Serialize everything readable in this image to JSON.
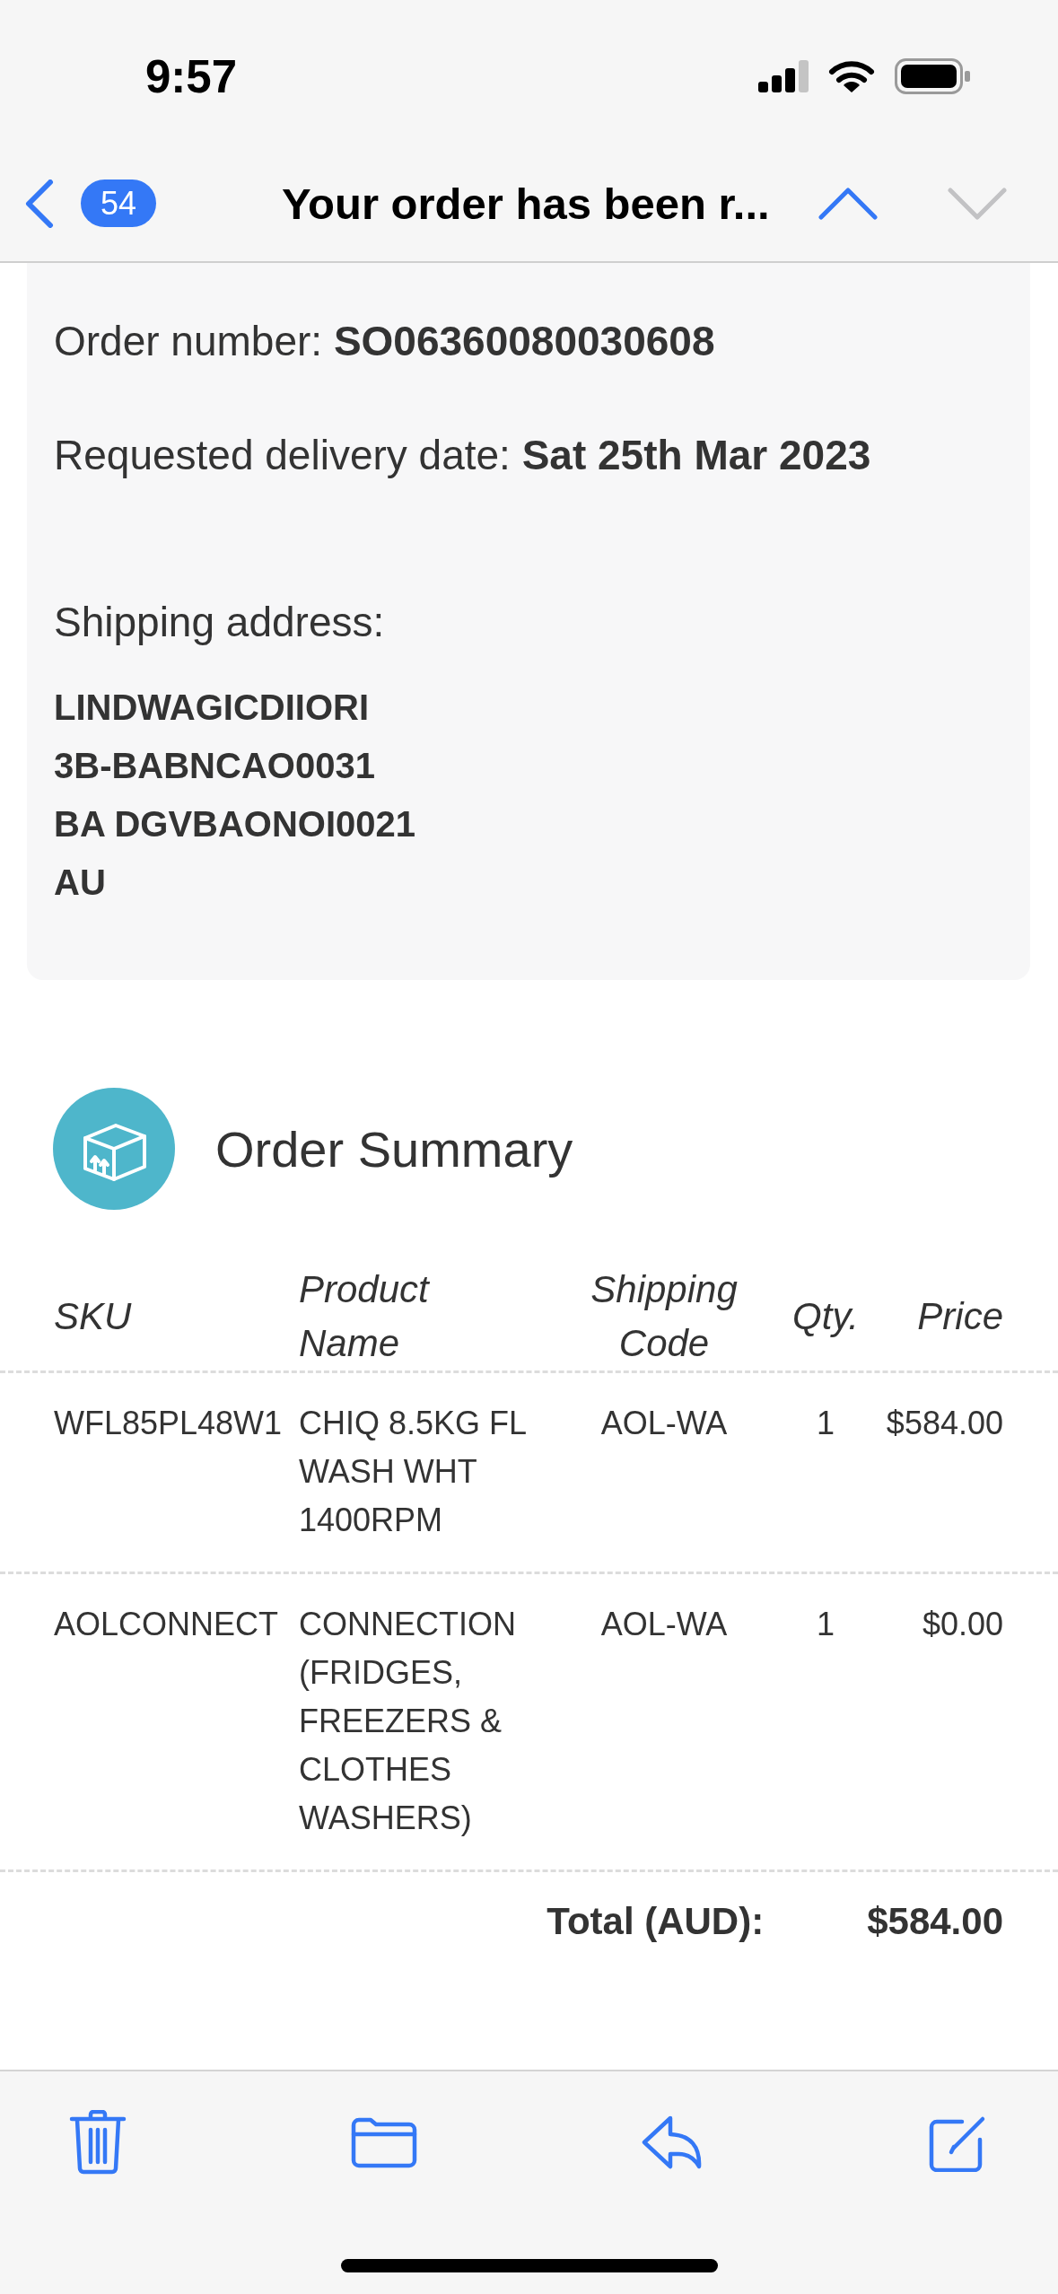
{
  "status_bar": {
    "time": "9:57"
  },
  "nav_bar": {
    "unread_count": "54",
    "title": "Your order has been r...",
    "arrows": [
      {
        "kind": "up",
        "disabled": false
      },
      {
        "kind": "down",
        "disabled": true
      }
    ]
  },
  "order_details": {
    "lines": [
      "Order number: **SO06360080030608**",
      "Requested delivery date: **Sat 25th Mar 2023**"
    ],
    "shipping_label": "Shipping address:",
    "address_lines": [
      "LINDWAGICDIIORI",
      "3B-BABNCAO0031",
      "BA DGVBAONOI0021",
      "AU"
    ]
  },
  "order_summary": {
    "title": "Order Summary",
    "columns": [
      "SKU",
      "Product Name",
      "Shipping Code",
      "Qty.",
      "Price"
    ],
    "rows": [
      {
        "sku": "WFL85PL48W1",
        "product_name": "CHIQ 8.5KG FL WASH WHT 1400RPM",
        "shipping_code": "AOL-WA",
        "qty": "1",
        "price": "$584.00"
      },
      {
        "sku": "AOLCONNECT",
        "product_name": "CONNECTION (FRIDGES, FREEZERS & CLOTHES WASHERS)",
        "shipping_code": "AOL-WA",
        "qty": "1",
        "price": "$0.00"
      }
    ],
    "total_label": "Total (AUD):",
    "total": "$584.00"
  }
}
